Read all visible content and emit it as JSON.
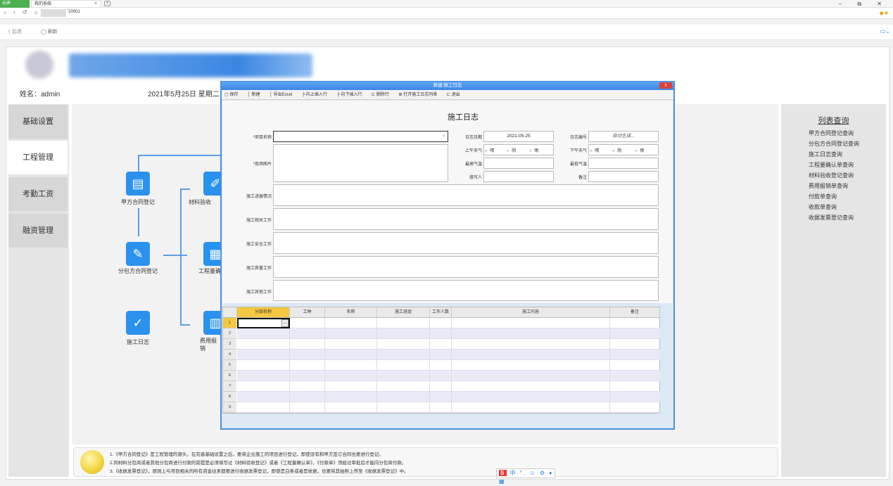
{
  "browser": {
    "tab_app": "云表",
    "tab_title": "我的系统",
    "tab_close": "×",
    "new_tab": "+",
    "window_controls": "–  ⧉  ✕",
    "url_suffix": "'10001",
    "back_label": "〈 后退",
    "refresh_label": "◯ 刷新"
  },
  "header": {
    "user": "姓名：admin",
    "date": "2021年5月25日  星期二"
  },
  "sidebar": {
    "items": [
      {
        "label": "基础设置"
      },
      {
        "label": "工程管理"
      },
      {
        "label": "考勤工资"
      },
      {
        "label": "融资管理"
      }
    ]
  },
  "flow": {
    "nodes": [
      {
        "label": "甲方合同登记",
        "icon": "document-plus-icon"
      },
      {
        "label": "分包方合同登记",
        "icon": "document-edit-icon"
      },
      {
        "label": "施工日志",
        "icon": "document-check-icon"
      },
      {
        "label": "材料验收",
        "icon": "ruler-pencil-icon"
      },
      {
        "label": "工程量确",
        "icon": "calendar-icon"
      },
      {
        "label": "费用报销",
        "icon": "table-icon"
      }
    ]
  },
  "right_panel": {
    "title": "列表查询",
    "links": [
      "甲方合同登记查询",
      "分包方合同登记查询",
      "施工日志查询",
      "工程量确认单查询",
      "材料验收登记查询",
      "费用报销单查询",
      "付款单查询",
      "收款单查询",
      "收据发票登记查询"
    ]
  },
  "tips": [
    "1.《甲方合同登记》是工程管理的源头，在完善基础设置之后，要将企业施工的项目进行登记，即使没有和甲方签订合同也要进行登记。",
    "2.同材料分包商或者其他分包商进行付款的前提是必须填写过《材料验收登记》或者《工程量确认单》，《付款单》须经过审批后才能向分包商付款。",
    "3.《收据发票登记》，原则上与项目相关的所有资金往来都要进行收据发票登记，即使是白条或者是收据，也要将其拍照上传至《收据发票登记》中。"
  ],
  "ime": {
    "logo": "S",
    "text": "中 °, ☺ ⚙ ♦ ▦"
  },
  "dialog": {
    "title": "新建:施工日志",
    "close": "x",
    "toolbar": [
      "保存",
      "新建",
      "导出Excel",
      "向上插入行",
      "向下插入行",
      "删除行",
      "打开施工日志列表",
      "退出"
    ],
    "form_title": "施工日志",
    "fields": {
      "project_name": "*项目名称",
      "site_photo": "*现场图片",
      "log_date_label": "日志日期",
      "log_date_value": "2021-05-25",
      "log_no_label": "日志编号",
      "log_no_value": "自动生成...",
      "am_weather": "上午天气",
      "pm_weather": "下午天气",
      "weather_options": [
        "晴",
        "阴",
        "雨"
      ],
      "max_temp": "最高气温",
      "min_temp": "最低气温",
      "author": "填写人",
      "remark": "备注",
      "progress": "施工进展情况",
      "related": "施工相关工作",
      "safety": "施工安全工作",
      "quality": "施工质量工作",
      "other": "施工其他工作"
    },
    "grid": {
      "columns": [
        "分部名称",
        "工种",
        "名称",
        "施工班组",
        "工作人数",
        "施工内容",
        "备注"
      ],
      "rows": [
        "1",
        "2",
        "3",
        "4",
        "5",
        "6",
        "7",
        "8",
        "9"
      ],
      "ellipsis": "..."
    }
  }
}
